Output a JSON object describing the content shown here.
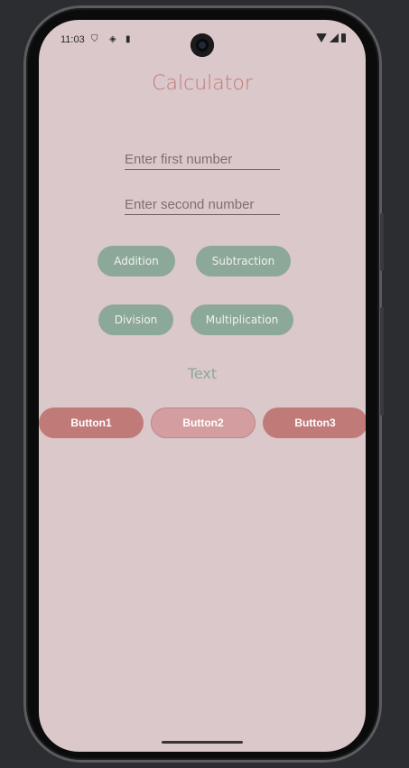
{
  "status_bar": {
    "time": "11:03",
    "icons": [
      "shield-icon",
      "location-icon",
      "sd-card-icon",
      "wifi-icon",
      "signal-icon",
      "battery-icon"
    ]
  },
  "app": {
    "title": "Calculator",
    "first_number": {
      "placeholder": "Enter first number",
      "value": ""
    },
    "second_number": {
      "placeholder": "Enter second number",
      "value": ""
    },
    "operations": {
      "addition": "Addition",
      "subtraction": "Subtraction",
      "division": "Division",
      "multiplication": "Multiplication"
    },
    "result_text": "Text",
    "bottom_buttons": {
      "button1": "Button1",
      "button2": "Button2",
      "button3": "Button3"
    }
  },
  "colors": {
    "background": "#dbc8ca",
    "title": "#c2787a",
    "operation_button": "#8ba898",
    "accent_button": "#c07b79",
    "secondary_button": "#d49ea1"
  }
}
